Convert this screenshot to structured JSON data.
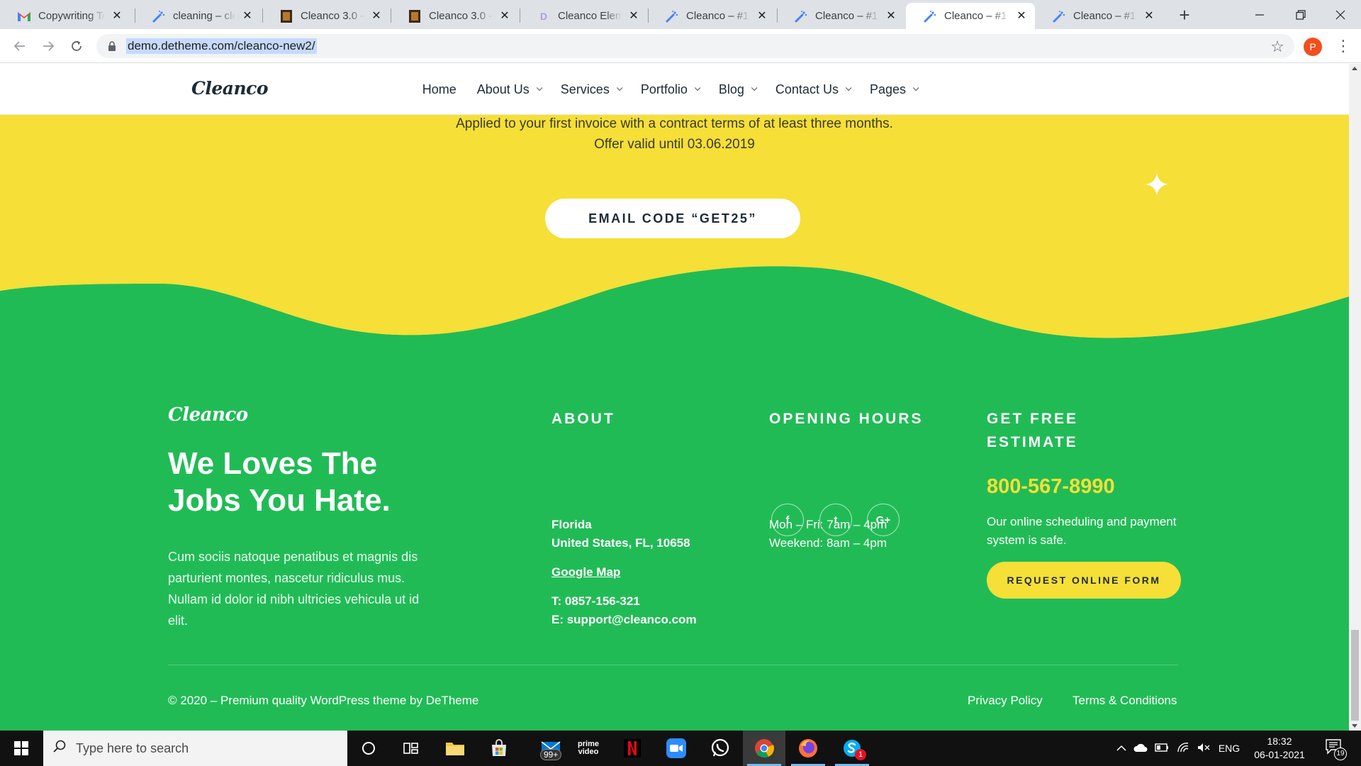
{
  "browser": {
    "tabs": [
      {
        "title": "Copywriting Te",
        "icon": "gmail-icon"
      },
      {
        "title": "cleaning – clea",
        "icon": "cleaning-brush-icon"
      },
      {
        "title": "Cleanco 3.0 - C",
        "icon": "theme-thumbnail-icon"
      },
      {
        "title": "Cleanco 3.0 - C",
        "icon": "theme-thumbnail-icon"
      },
      {
        "title": "Cleanco Elemen",
        "icon": "letter-d-icon"
      },
      {
        "title": "Cleanco – #1 S",
        "icon": "cleaning-brush-icon"
      },
      {
        "title": "Cleanco – #1 S",
        "icon": "cleaning-brush-icon"
      },
      {
        "title": "Cleanco – #1 S",
        "icon": "cleaning-brush-icon",
        "active": true
      },
      {
        "title": "Cleanco – #1 S",
        "icon": "cleaning-brush-icon"
      }
    ],
    "url": "demo.detheme.com/cleanco-new2/",
    "profile_initial": "P"
  },
  "site": {
    "logo": "Cleanco",
    "nav": [
      "Home",
      "About Us",
      "Services",
      "Portfolio",
      "Blog",
      "Contact Us",
      "Pages"
    ]
  },
  "promo": {
    "line1": "Applied to your first invoice with a contract terms of at least three months.",
    "line2": "Offer valid until 03.06.2019",
    "button": "EMAIL CODE “GET25”"
  },
  "footer": {
    "logo": "Cleanco",
    "tagline_1": "We Loves The",
    "tagline_2": "Jobs You Hate.",
    "blurb": "Cum sociis natoque penatibus et magnis dis parturient montes, nascetur ridiculus mus. Nullam id dolor id nibh ultricies vehicula ut id elit.",
    "about": {
      "heading": "ABOUT",
      "line1": "Florida",
      "line2": "United States, FL, 10658",
      "map_link": "Google Map",
      "phone": "T: 0857-156-321",
      "email": "E: support@cleanco.com"
    },
    "hours": {
      "heading": "OPENING HOURS",
      "weekdays": "Mon – Fri: 7am – 4pm",
      "weekend": "Weekend: 8am – 4pm",
      "social": [
        "f",
        "t",
        "G+"
      ]
    },
    "estimate": {
      "heading_1": "GET FREE",
      "heading_2": "ESTIMATE",
      "phone": "800-567-8990",
      "text_1": "Our online scheduling and payment",
      "text_2": "system is safe.",
      "button": "REQUEST ONLINE FORM"
    },
    "copyright": "© 2020 – Premium quality WordPress theme by DeTheme",
    "links": [
      "Privacy Policy",
      "Terms & Conditions"
    ]
  },
  "taskbar": {
    "search_placeholder": "Type here to search",
    "mail_badge": "99+",
    "prime_label": "prime video",
    "skype_badge": "1",
    "language": "ENG",
    "time": "18:32",
    "date": "06-01-2021",
    "notification_count": "19"
  },
  "colors": {
    "brand_green": "#21bb56",
    "brand_yellow": "#f6df37",
    "text_dark": "#1d2b36"
  }
}
